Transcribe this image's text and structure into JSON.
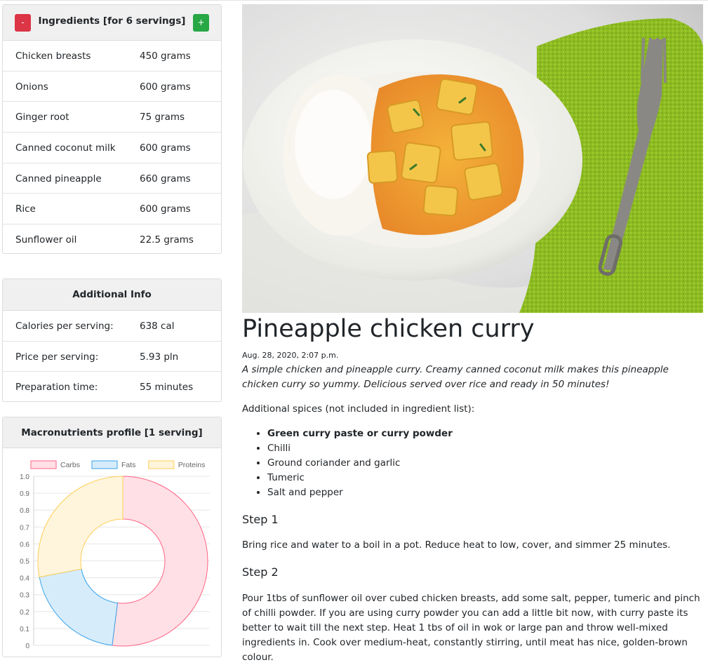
{
  "ingredients_card": {
    "title": "Ingredients [for 6 servings]",
    "minus_label": "-",
    "plus_label": "+",
    "items": [
      {
        "name": "Chicken breasts",
        "amount": "450 grams"
      },
      {
        "name": "Onions",
        "amount": "600 grams"
      },
      {
        "name": "Ginger root",
        "amount": "75 grams"
      },
      {
        "name": "Canned coconut milk",
        "amount": "600 grams"
      },
      {
        "name": "Canned pineapple",
        "amount": "660 grams"
      },
      {
        "name": "Rice",
        "amount": "600 grams"
      },
      {
        "name": "Sunflower oil",
        "amount": "22.5 grams"
      }
    ]
  },
  "additional_info": {
    "title": "Additional Info",
    "items": [
      {
        "label": "Calories per serving:",
        "value": "638 cal"
      },
      {
        "label": "Price per serving:",
        "value": "5.93 pln"
      },
      {
        "label": "Preparation time:",
        "value": "55 minutes"
      }
    ]
  },
  "macro_card": {
    "title": "Macronutrients profile [1 serving]"
  },
  "chart_data": {
    "type": "doughnut",
    "categories": [
      "Carbs",
      "Fats",
      "Proteins"
    ],
    "values": [
      0.52,
      0.2,
      0.28
    ],
    "colors": [
      "#ff6384",
      "#36a2eb",
      "#ffce56"
    ],
    "fill_colors": [
      "#ffe0e6",
      "#d7ecfb",
      "#fff5dd"
    ],
    "yticks": [
      "1.0",
      "0.9",
      "0.8",
      "0.7",
      "0.6",
      "0.5",
      "0.4",
      "0.3",
      "0.2",
      "0.1",
      "0"
    ],
    "ylim": [
      0,
      1
    ],
    "legend_position": "top",
    "grid": true
  },
  "recipe": {
    "title": "Pineapple chicken curry",
    "date": "Aug. 28, 2020, 2:07 p.m.",
    "description": "A simple chicken and pineapple curry. Creamy canned coconut milk makes this pineapple chicken curry so yummy. Delicious served over rice and ready in 50 minutes!",
    "spices_intro": "Additional spices (not included in ingredient list):",
    "spices": [
      "Green curry paste or curry powder",
      "Chilli",
      "Ground coriander and garlic",
      "Tumeric",
      "Salt and pepper"
    ],
    "steps": [
      {
        "title": "Step 1",
        "text": "Bring rice and water to a boil in a pot. Reduce heat to low, cover, and simmer 25 minutes."
      },
      {
        "title": "Step 2",
        "text": "Pour 1tbs of sunflower oil over cubed chicken breasts, add some salt, pepper, tumeric and pinch of chilli powder. If you are using curry powder you can add a little bit now, with curry paste its better to wait till the next step. Heat 1 tbs of oil in wok or large pan and throw well-mixed ingredients in.  Cook over medium-heat, constantly stirring, until meat has nice, golden-brown colour."
      }
    ]
  }
}
